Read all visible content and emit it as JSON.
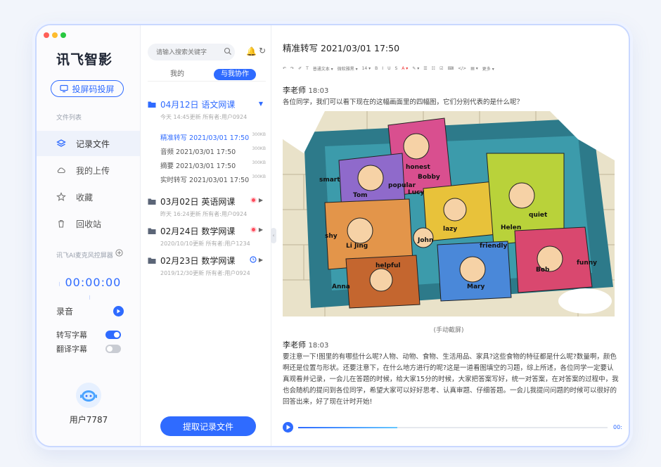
{
  "sidebar": {
    "logo": "讯飞智影",
    "cast_button": "投屏码投屏",
    "file_list_label": "文件列表",
    "nav": [
      {
        "label": "记录文件",
        "icon": "layers-icon",
        "active": true
      },
      {
        "label": "我的上传",
        "icon": "cloud-icon",
        "active": false
      },
      {
        "label": "收藏",
        "icon": "star-icon",
        "active": false
      },
      {
        "label": "回收站",
        "icon": "trash-icon",
        "active": false
      }
    ],
    "device_label": "讯飞AI麦克风控屏器",
    "timer": "00:00:00",
    "record_label": "录音",
    "subtitle_label": "转写字幕",
    "subtitle_on": true,
    "translate_label": "翻译字幕",
    "translate_on": false,
    "username": "用户7787"
  },
  "files": {
    "search_placeholder": "请输入搜索关键字",
    "tabs": [
      "我的",
      "与我协作"
    ],
    "active_tab": 1,
    "folders": [
      {
        "title": "04月12日 语文网课",
        "meta": "今天 14:45更新 所有者:用户0924",
        "expanded": true,
        "children": [
          {
            "label": "精准转写 2021/03/01 17:50",
            "size": "300KB",
            "selected": true
          },
          {
            "label": "音频 2021/03/01 17:50",
            "size": "300KB",
            "selected": false
          },
          {
            "label": "摘要 2021/03/01 17:50",
            "size": "300KB",
            "selected": false
          },
          {
            "label": "实时转写 2021/03/01 17:50",
            "size": "300KB",
            "selected": false
          }
        ]
      },
      {
        "title": "03月02日 英语网课",
        "meta": "昨天 16:24更新 所有者:用户0924",
        "status": "recording"
      },
      {
        "title": "02月24日 数学网课",
        "meta": "2020/10/10更新 所有者:用户1234",
        "status": "recording"
      },
      {
        "title": "02月23日 数学网课",
        "meta": "2019/12/30更新 所有者:用户0924",
        "status": "scheduled"
      }
    ],
    "extract_button": "提取记录文件"
  },
  "content": {
    "title": "精准转写 2021/03/01 17:50",
    "toolbar": [
      "↶",
      "↷",
      "✐",
      "T",
      "普通文本 ▾",
      "微软雅黑 ▾",
      "14 ▾",
      "B",
      "I",
      "U",
      "S",
      "A ▾",
      "✎ ▾",
      "☰",
      "☷",
      "☑",
      "⌨",
      "</>",
      "▤ ▾",
      "更多 ▾"
    ],
    "block1": {
      "speaker": "李老师",
      "time": "18:03",
      "text": "各位同学，我们可以看下现在的这幅画面里的四幅图，它们分别代表的是什么呢？"
    },
    "image_labels": [
      "honest",
      "Bobby",
      "smart",
      "Tom",
      "popular",
      "Lucy",
      "quiet",
      "Helen",
      "lazy",
      "shy",
      "John",
      "Li Jing",
      "friendly",
      "helpful",
      "funny",
      "Bob",
      "Anna",
      "Mary"
    ],
    "caption": "(手动截屏)",
    "block2": {
      "speaker": "李老师",
      "time": "18:03",
      "text": "要注意一下!图里的有哪些什么呢?人物、动物、食物、生活用品、家具?这些食物的特征都是什么呢?数量啊，颜色啊还是位置与形状。还要注意下，在什么地方进行的呢?这是一道看图填空的习题，综上所述，各位同学一定要认真观看并记录，一会儿在答题的时候，给大家15分的时候，大家把答案写好，统一对答案，在对答案的过程中，我也会随机的提问到各位同学，希望大家可以好好思考、认真审题、仔细答题。一会儿我提问问题的时候可以很好的回答出来，好了现在计时开始!"
    },
    "player": {
      "progress": 0.32,
      "time": "00:"
    }
  },
  "colors": {
    "accent": "#2f6bff",
    "red": "#ff4b5c"
  }
}
